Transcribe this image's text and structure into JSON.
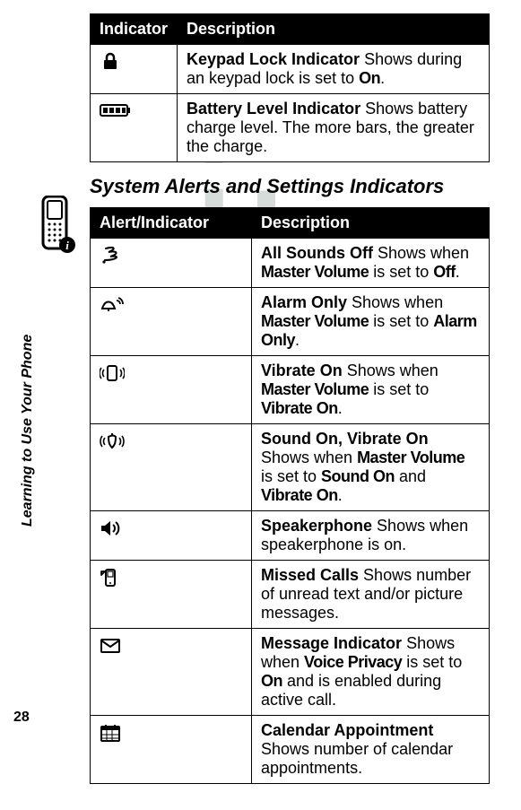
{
  "watermark": "DRAFT",
  "sidebar_label": "Learning to Use Your Phone",
  "page_number": "28",
  "table1": {
    "headers": {
      "col1": "Indicator",
      "col2": "Description"
    },
    "rows": [
      {
        "icon": "lock-icon",
        "title": "Keypad Lock Indicator",
        "body_before": "  Shows during an keypad lock is set to ",
        "cond1": "On",
        "body_after": "."
      },
      {
        "icon": "battery-icon",
        "title": "Battery Level Indicator",
        "body_before": "  Shows battery charge level. The more bars, the greater the charge.",
        "cond1": "",
        "body_after": ""
      }
    ]
  },
  "section_heading": "System Alerts and Settings Indicators",
  "table2": {
    "headers": {
      "col1": "Alert/Indicator",
      "col2": "Description"
    },
    "rows": [
      {
        "icon": "sounds-off-icon",
        "title": "All Sounds Off",
        "segments": [
          {
            "t": "  Shows when ",
            "c": false
          },
          {
            "t": "Master Volume",
            "c": true
          },
          {
            "t": " is set to ",
            "c": false
          },
          {
            "t": "Off",
            "c": true
          },
          {
            "t": ".",
            "c": false
          }
        ]
      },
      {
        "icon": "alarm-only-icon",
        "title": "Alarm Only",
        "segments": [
          {
            "t": "  Shows when ",
            "c": false
          },
          {
            "t": "Master Volume",
            "c": true
          },
          {
            "t": " is set to ",
            "c": false
          },
          {
            "t": "Alarm Only",
            "c": true
          },
          {
            "t": ".",
            "c": false
          }
        ]
      },
      {
        "icon": "vibrate-on-icon",
        "title": "Vibrate On",
        "segments": [
          {
            "t": "  Shows when ",
            "c": false
          },
          {
            "t": "Master Volume",
            "c": true
          },
          {
            "t": " is set to ",
            "c": false
          },
          {
            "t": "Vibrate On",
            "c": true
          },
          {
            "t": ".",
            "c": false
          }
        ]
      },
      {
        "icon": "sound-vibrate-icon",
        "title": "Sound On, Vibrate On",
        "segments": [
          {
            "t": "  Shows when ",
            "c": false
          },
          {
            "t": "Master Volume",
            "c": true
          },
          {
            "t": " is set to ",
            "c": false
          },
          {
            "t": "Sound On",
            "c": true
          },
          {
            "t": " and ",
            "c": false
          },
          {
            "t": "Vibrate On",
            "c": true
          },
          {
            "t": ".",
            "c": false
          }
        ]
      },
      {
        "icon": "speakerphone-icon",
        "title": "Speakerphone",
        "segments": [
          {
            "t": "  Shows when speakerphone is on.",
            "c": false
          }
        ]
      },
      {
        "icon": "missed-calls-icon",
        "title": "Missed Calls",
        "segments": [
          {
            "t": "  Shows number of unread text and/or picture messages.",
            "c": false
          }
        ]
      },
      {
        "icon": "message-indicator-icon",
        "title": "Message Indicator",
        "segments": [
          {
            "t": "  Shows when ",
            "c": false
          },
          {
            "t": "Voice Privacy",
            "c": true
          },
          {
            "t": " is set to ",
            "c": false
          },
          {
            "t": "On",
            "c": true
          },
          {
            "t": " and is enabled during active call.",
            "c": false
          }
        ]
      },
      {
        "icon": "calendar-icon",
        "title": "Calendar Appointment",
        "segments": [
          {
            "t": "  Shows number of calendar appointments.",
            "c": false
          }
        ]
      }
    ]
  }
}
